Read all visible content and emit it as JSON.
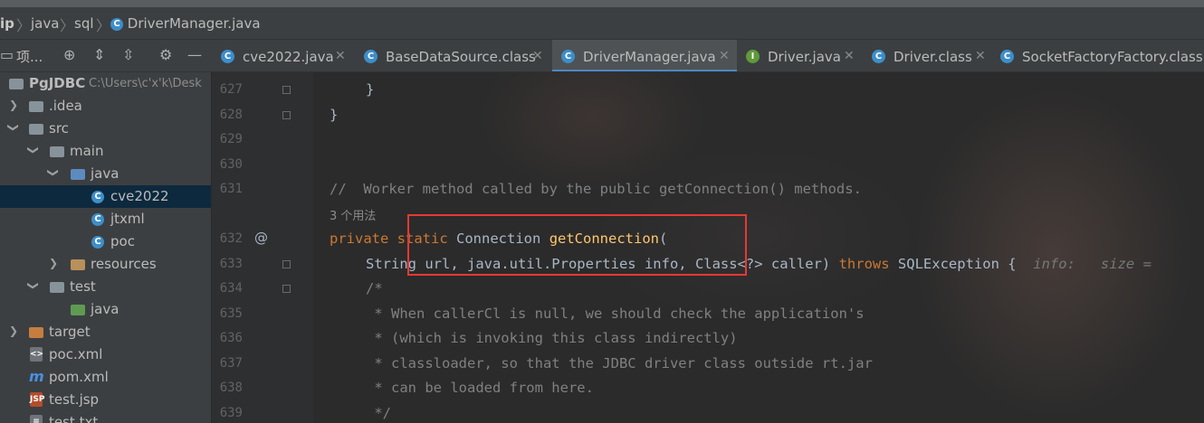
{
  "breadcrumb": {
    "items": [
      "ip",
      "java",
      "sql",
      "DriverManager.java"
    ]
  },
  "project_panel": {
    "title": "项...",
    "tree": [
      {
        "label": "PgJDBC",
        "hint": "C:\\Users\\c'x'k\\Desk"
      },
      {
        "label": ".idea"
      },
      {
        "label": "src"
      },
      {
        "label": "main"
      },
      {
        "label": "java"
      },
      {
        "label": "cve2022"
      },
      {
        "label": "jtxml"
      },
      {
        "label": "poc"
      },
      {
        "label": "resources"
      },
      {
        "label": "test"
      },
      {
        "label": "java"
      },
      {
        "label": "target"
      },
      {
        "label": "poc.xml"
      },
      {
        "label": "pom.xml"
      },
      {
        "label": "test.jsp"
      },
      {
        "label": "test.txt"
      }
    ]
  },
  "tabs": [
    {
      "label": "cve2022.java",
      "icon": "C"
    },
    {
      "label": "BaseDataSource.class",
      "icon": "C"
    },
    {
      "label": "DriverManager.java",
      "icon": "C",
      "active": true
    },
    {
      "label": "Driver.java",
      "icon": "I"
    },
    {
      "label": "Driver.class",
      "icon": "C"
    },
    {
      "label": "SocketFactoryFactory.class",
      "icon": "C"
    }
  ],
  "editor": {
    "line_numbers": [
      "627",
      "628",
      "629",
      "630",
      "631",
      "632",
      "633",
      "634",
      "635",
      "636",
      "637",
      "638",
      "639"
    ],
    "usages_hint": "3 个用法",
    "gutter_marker": "@",
    "code": {
      "l627": "}",
      "l628": "}",
      "l631": "//  Worker method called by the public getConnection() methods.",
      "l632_kw1": "private",
      "l632_kw2": "static",
      "l632_type": "Connection",
      "l632_fn": "getConnection",
      "l632_paren": "(",
      "l633_a": "String url, java.util.Properties info, Class<?> caller) ",
      "l633_kw": "throws",
      "l633_b": " SQLException {",
      "l633_inlay": "info:   size =",
      "l634": "/*",
      "l635": " * When callerCl is null, we should check the application's",
      "l636": " * (which is invoking this class indirectly)",
      "l637": " * classloader, so that the JDBC driver class outside rt.jar",
      "l638": " * can be loaded from here.",
      "l639": " */"
    }
  },
  "colors": {
    "highlight_box": "#e53935",
    "keyword": "#cc7832",
    "method": "#ffc66d",
    "comment": "#808080"
  }
}
